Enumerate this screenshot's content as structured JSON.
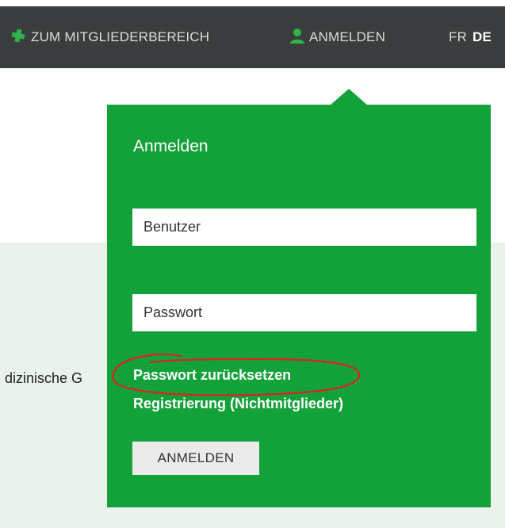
{
  "topbar": {
    "members_label": "ZUM MITGLIEDERBEREICH",
    "members_icon": "puzzle-cross-icon",
    "login_label": "ANMELDEN",
    "login_icon": "user-icon",
    "lang_fr": "FR",
    "lang_de": "DE",
    "icon_color": "#2fb34a"
  },
  "background": {
    "partial_text": "dizinische G"
  },
  "login_dropdown": {
    "title": "Anmelden",
    "username_placeholder": "Benutzer",
    "password_placeholder": "Passwort",
    "reset_link": "Passwort zurücksetzen",
    "register_link": "Registrierung (Nichtmitglieder)",
    "submit_label": "ANMELDEN",
    "accent_color": "#13a13a"
  },
  "annotation": {
    "color": "#e02020",
    "icon": "red-circle-annotation"
  }
}
